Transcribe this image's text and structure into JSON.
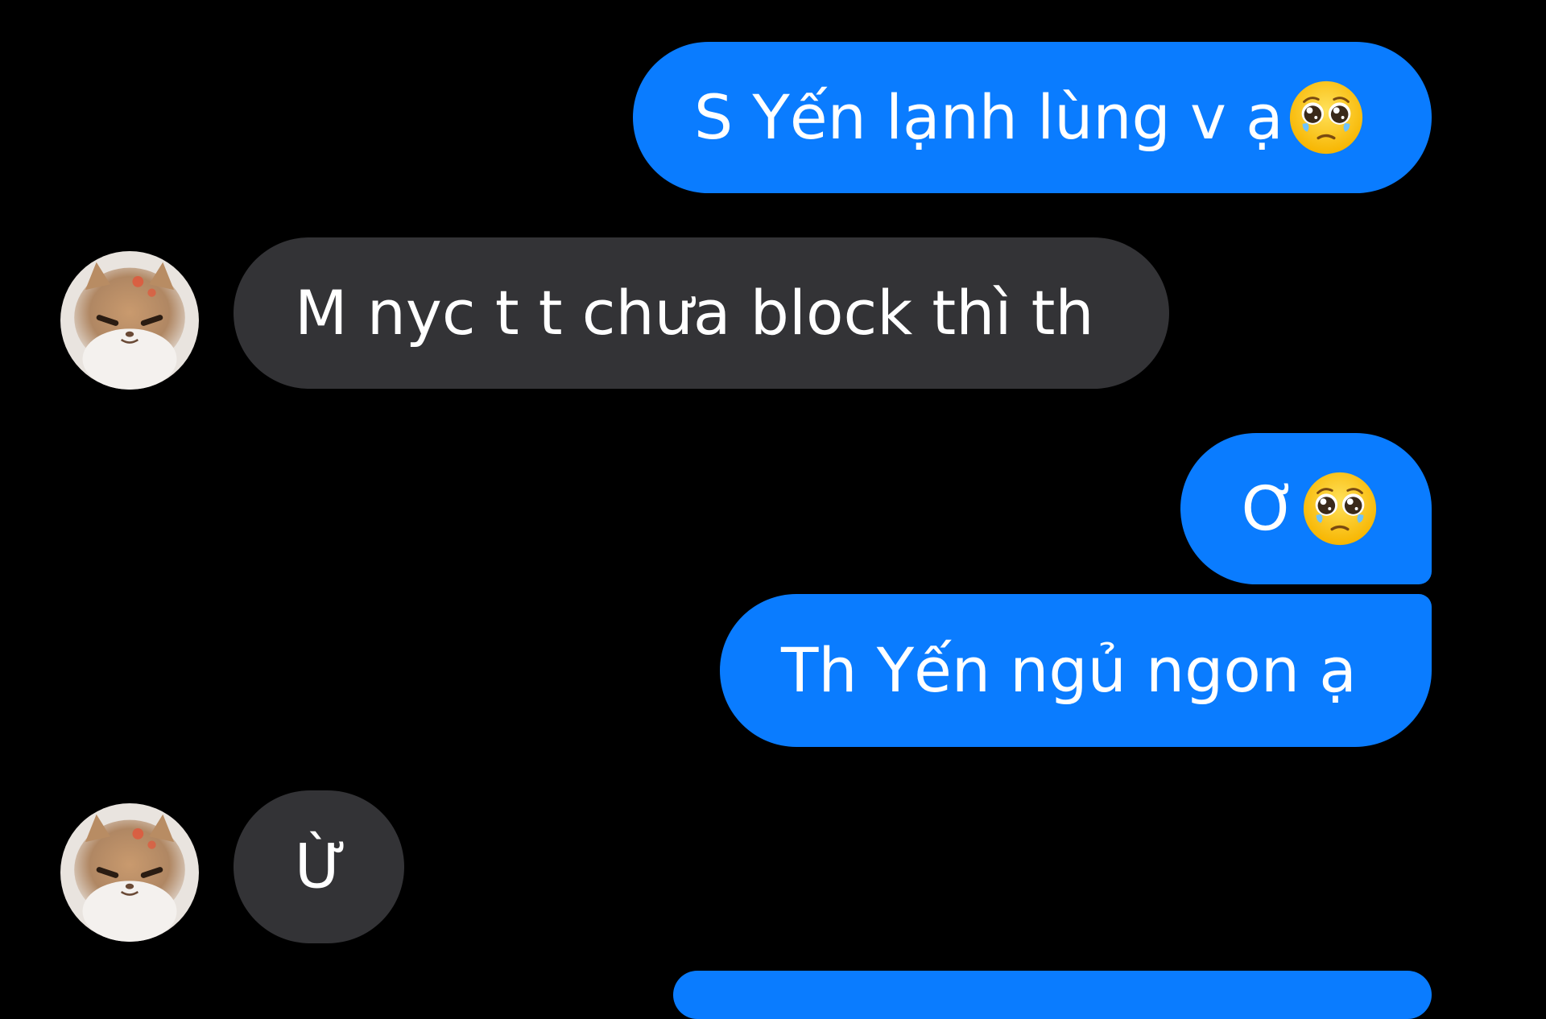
{
  "conversation": {
    "messages": [
      {
        "sender": "me",
        "text": "S Yến lạnh lùng v ạ",
        "emoji": "pleading-face-icon"
      },
      {
        "sender": "contact",
        "text": "M nyc t t chưa block thì th"
      },
      {
        "sender": "me",
        "text": "Ơ",
        "emoji": "pleading-face-icon"
      },
      {
        "sender": "me",
        "text": "Th Yến ngủ ngon ạ"
      },
      {
        "sender": "contact",
        "text": "Ừ"
      }
    ]
  },
  "colors": {
    "background": "#000000",
    "outgoing_bubble": "#0a7cff",
    "incoming_bubble": "#333336",
    "text": "#ffffff"
  }
}
